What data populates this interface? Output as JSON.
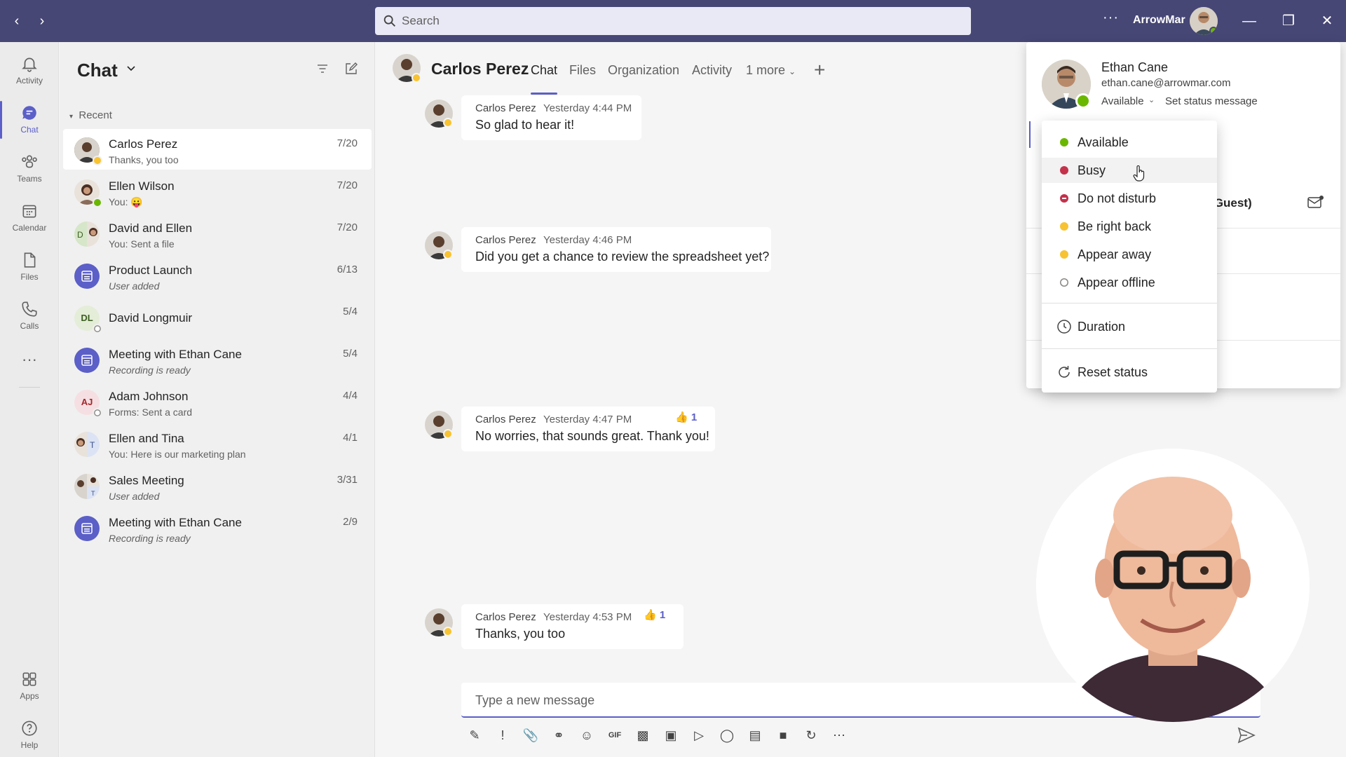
{
  "titlebar": {
    "search_placeholder": "Search",
    "org_name": "ArrowMar",
    "more_label": "···"
  },
  "rail": {
    "items": [
      {
        "label": "Activity"
      },
      {
        "label": "Chat"
      },
      {
        "label": "Teams"
      },
      {
        "label": "Calendar"
      },
      {
        "label": "Files"
      },
      {
        "label": "Calls"
      },
      {
        "label": "Apps"
      },
      {
        "label": "Help"
      }
    ],
    "more_label": "···"
  },
  "chatlist": {
    "title": "Chat",
    "section": "Recent",
    "items": [
      {
        "name": "Carlos Perez",
        "preview": "Thanks, you too",
        "date": "7/20"
      },
      {
        "name": "Ellen Wilson",
        "preview": "You: 😛",
        "date": "7/20"
      },
      {
        "name": "David and Ellen",
        "preview": "You: Sent a file",
        "date": "7/20"
      },
      {
        "name": "Product Launch",
        "preview": "User added",
        "date": "6/13"
      },
      {
        "name": "David Longmuir",
        "initials": "DL",
        "preview": "",
        "date": "5/4"
      },
      {
        "name": "Meeting with Ethan Cane",
        "preview": "Recording is ready",
        "date": "5/4"
      },
      {
        "name": "Adam Johnson",
        "initials": "AJ",
        "preview": "Forms: Sent a card",
        "date": "4/4"
      },
      {
        "name": "Ellen and Tina",
        "preview": "You: Here is our marketing plan",
        "date": "4/1"
      },
      {
        "name": "Sales Meeting",
        "preview": "User added",
        "date": "3/31"
      },
      {
        "name": "Meeting with Ethan Cane",
        "preview": "Recording is ready",
        "date": "2/9"
      }
    ]
  },
  "chat_header": {
    "name": "Carlos Perez",
    "tabs": [
      "Chat",
      "Files",
      "Organization",
      "Activity",
      "1 more"
    ]
  },
  "messages": [
    {
      "sender": "Carlos Perez",
      "time": "Yesterday 4:44 PM",
      "text": "So glad to hear it!"
    },
    {
      "sender": "Carlos Perez",
      "time": "Yesterday 4:46 PM",
      "text": "Did you get a chance to review the spreadsheet yet?"
    },
    {
      "sender": "Carlos Perez",
      "time": "Yesterday 4:47 PM",
      "text": "No worries, that sounds great. Thank you!",
      "reaction": "👍",
      "reaction_count": "1"
    },
    {
      "sender": "Carlos Perez",
      "time": "Yesterday 4:53 PM",
      "text": "Thanks, you too",
      "reaction": "👍",
      "reaction_count": "1"
    }
  ],
  "compose": {
    "placeholder": "Type a new message"
  },
  "profile_card": {
    "name": "Ethan Cane",
    "email": "ethan.cane@arrowmar.com",
    "status": "Available",
    "set_status_message": "Set status message",
    "guest_fragment": "r. (Guest)"
  },
  "status_menu": {
    "items": [
      {
        "label": "Available",
        "color": "#6bb700"
      },
      {
        "label": "Busy",
        "color": "#c4314b"
      },
      {
        "label": "Do not disturb",
        "color": "#c4314b"
      },
      {
        "label": "Be right back",
        "color": "#f8c332"
      },
      {
        "label": "Appear away",
        "color": "#f8c332"
      },
      {
        "label": "Appear offline",
        "color": "#8a8886"
      }
    ],
    "duration_label": "Duration",
    "reset_label": "Reset status"
  },
  "colors": {
    "titlebar": "#464775",
    "accent": "#5b5fc7",
    "available": "#6bb700",
    "away": "#f8c332",
    "busy": "#c4314b"
  }
}
